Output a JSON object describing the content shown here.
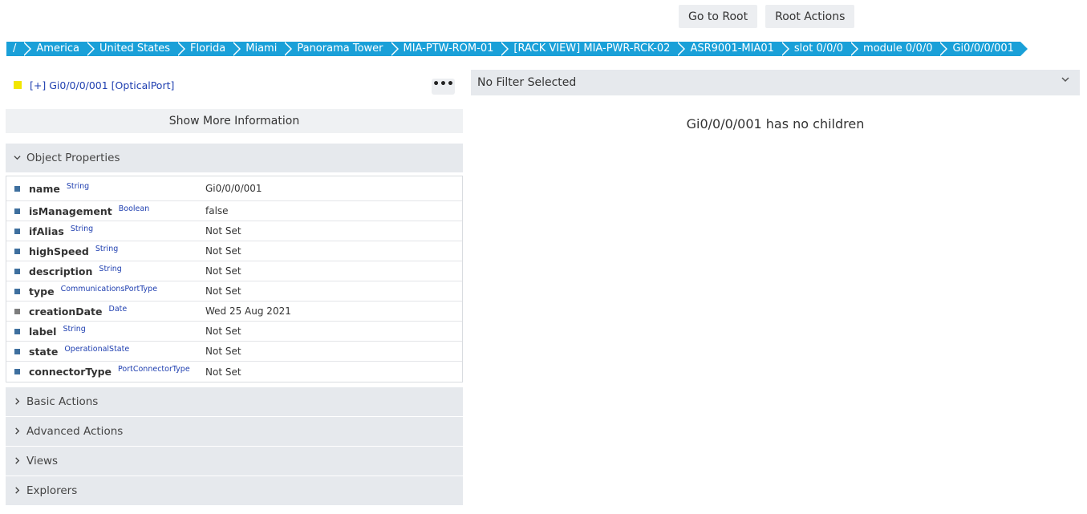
{
  "top_buttons": {
    "go_root": "Go to Root",
    "root_actions": "Root Actions"
  },
  "breadcrumb": [
    "/",
    "America",
    "United States",
    "Florida",
    "Miami",
    "Panorama Tower",
    "MIA-PTW-ROM-01",
    "[RACK VIEW] MIA-PWR-RCK-02",
    "ASR9001-MIA01",
    "slot 0/0/0",
    "module 0/0/0",
    "Gi0/0/0/001"
  ],
  "object": {
    "title": "[+] Gi0/0/0/001 [OpticalPort]",
    "more_label": "•••",
    "color": "#f2e600"
  },
  "show_more": "Show More Information",
  "object_properties": {
    "label": "Object Properties",
    "rows": [
      {
        "name": "name",
        "type": "String",
        "value": "Gi0/0/0/001"
      },
      {
        "name": "isManagement",
        "type": "Boolean",
        "value": "false"
      },
      {
        "name": "ifAlias",
        "type": "String",
        "value": "Not Set"
      },
      {
        "name": "highSpeed",
        "type": "String",
        "value": "Not Set"
      },
      {
        "name": "description",
        "type": "String",
        "value": "Not Set"
      },
      {
        "name": "type",
        "type": "CommunicationsPortType",
        "value": "Not Set"
      },
      {
        "name": "creationDate",
        "type": "Date",
        "value": "Wed 25 Aug 2021"
      },
      {
        "name": "label",
        "type": "String",
        "value": "Not Set"
      },
      {
        "name": "state",
        "type": "OperationalState",
        "value": "Not Set"
      },
      {
        "name": "connectorType",
        "type": "PortConnectorType",
        "value": "Not Set"
      }
    ]
  },
  "panels": {
    "basic_actions": "Basic Actions",
    "advanced_actions": "Advanced Actions",
    "views": "Views",
    "explorers": "Explorers"
  },
  "filter": {
    "selected": "No Filter Selected"
  },
  "children_message": "Gi0/0/0/001 has no children",
  "colors": {
    "breadcrumb": "#1aa0d8",
    "type_link": "#1f3fb0",
    "panel_bg": "#e6e9ed"
  }
}
